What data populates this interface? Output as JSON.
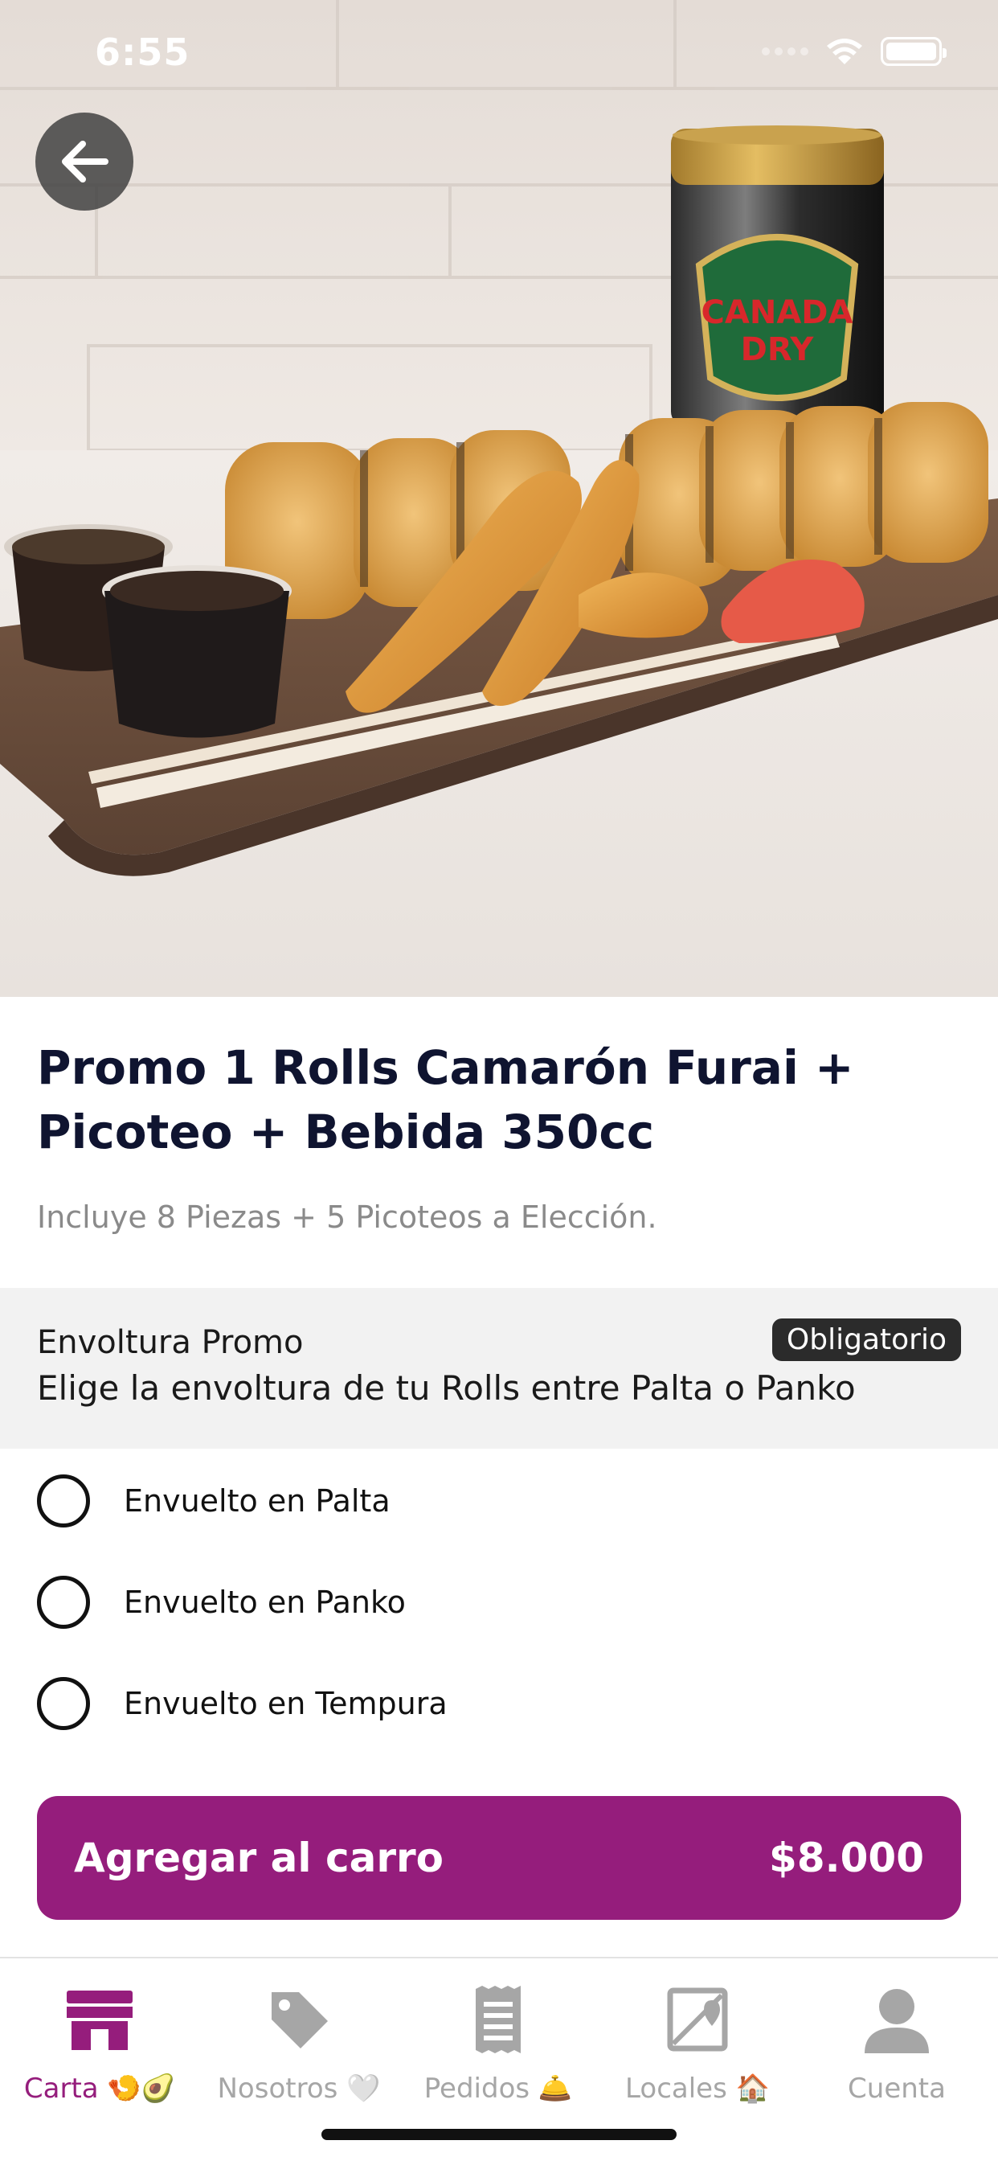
{
  "status_bar": {
    "time": "6:55"
  },
  "product": {
    "title": "Promo 1 Rolls Camarón Furai + Picoteo + Bebida 350cc",
    "description": "Incluye 8 Piezas + 5 Picoteos a Elección.",
    "image_text": {
      "can_brand_line1": "CANADA",
      "can_brand_line2": "DRY"
    }
  },
  "option_group": {
    "name": "Envoltura Promo",
    "description": "Elige la envoltura de tu Rolls entre Palta o Panko",
    "badge": "Obligatorio",
    "options": [
      {
        "label": "Envuelto en Palta",
        "selected": false
      },
      {
        "label": "Envuelto en Panko",
        "selected": false
      },
      {
        "label": "Envuelto en Tempura",
        "selected": false
      }
    ]
  },
  "cart_button": {
    "label": "Agregar al carro",
    "price": "$8.000"
  },
  "tabs": [
    {
      "label": "Carta 🍤🥑",
      "icon": "store-icon",
      "active": true
    },
    {
      "label": "Nosotros 🤍",
      "icon": "tag-icon",
      "active": false
    },
    {
      "label": "Pedidos 🛎️",
      "icon": "receipt-icon",
      "active": false
    },
    {
      "label": "Locales 🏠",
      "icon": "map-icon",
      "active": false
    },
    {
      "label": "Cuenta",
      "icon": "user-icon",
      "active": false
    }
  ],
  "colors": {
    "accent": "#951d7c",
    "title": "#0f1430",
    "inactive": "#a6a6a6"
  }
}
